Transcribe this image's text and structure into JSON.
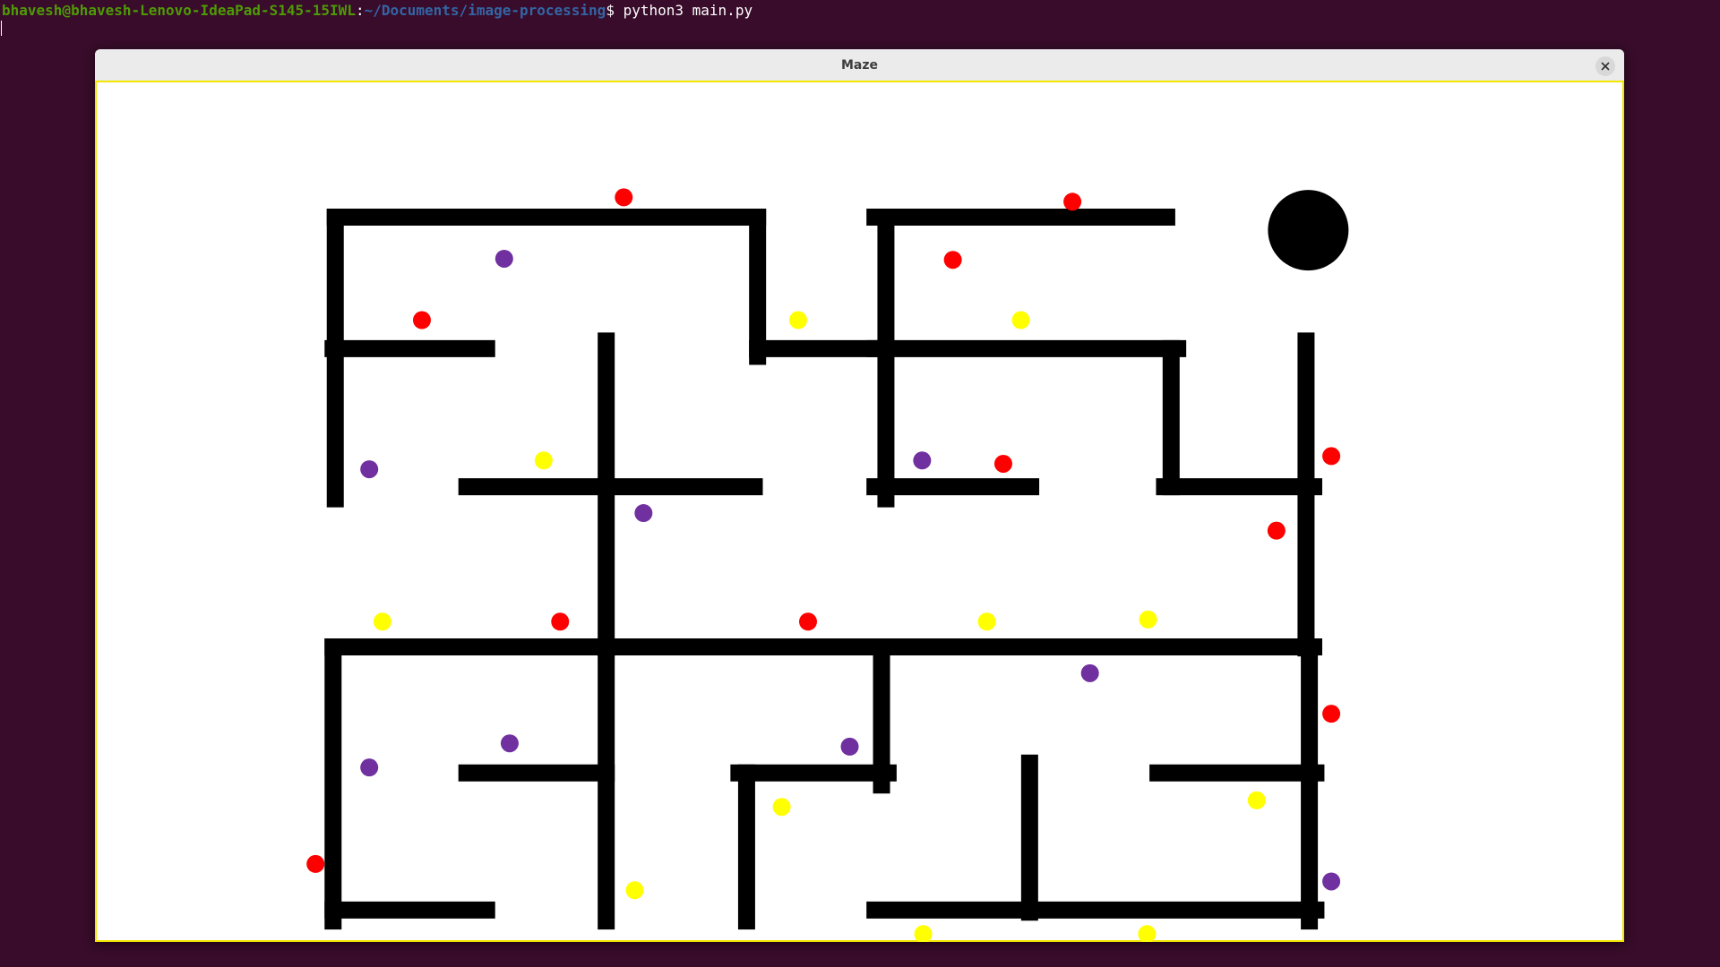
{
  "terminal": {
    "user_host": "bhavesh@bhavesh-Lenovo-IdeaPad-S145-15IWL",
    "separator": ":",
    "path": "~/Documents/image-processing",
    "dollar": "$",
    "command": " python3 main.py"
  },
  "window": {
    "title": "Maze",
    "close_icon": "close-icon"
  },
  "colors": {
    "terminal_bg": "#380c2a",
    "wall": "#000000",
    "red": "#ff0000",
    "yellow": "#ffff00",
    "purple": "#7030a0",
    "player": "#000000"
  },
  "maze": {
    "walls": [
      [
        304,
        198,
        689,
        198
      ],
      [
        304,
        198,
        304,
        455
      ],
      [
        689,
        198,
        689,
        325
      ],
      [
        689,
        318,
        806,
        318
      ],
      [
        302,
        318,
        442,
        318
      ],
      [
        551,
        311,
        551,
        591
      ],
      [
        424,
        444,
        686,
        444
      ],
      [
        806,
        198,
        806,
        455
      ],
      [
        796,
        198,
        1062,
        198
      ],
      [
        796,
        318,
        1072,
        318
      ],
      [
        1066,
        318,
        1066,
        444
      ],
      [
        796,
        444,
        938,
        444
      ],
      [
        1060,
        444,
        1196,
        444
      ],
      [
        1189,
        311,
        1189,
        591
      ],
      [
        302,
        590,
        1196,
        590
      ],
      [
        302,
        590,
        302,
        840
      ],
      [
        551,
        590,
        551,
        840
      ],
      [
        424,
        705,
        551,
        705
      ],
      [
        302,
        830,
        442,
        830
      ],
      [
        802,
        590,
        802,
        716
      ],
      [
        672,
        705,
        808,
        705
      ],
      [
        679,
        705,
        679,
        840
      ],
      [
        937,
        696,
        937,
        832
      ],
      [
        796,
        830,
        1198,
        830
      ],
      [
        1192,
        590,
        1192,
        840
      ],
      [
        1054,
        705,
        1198,
        705
      ]
    ],
    "player": [
      1191,
      210
    ],
    "dots": [
      [
        "red",
        567,
        180
      ],
      [
        "red",
        976,
        184
      ],
      [
        "purple",
        458,
        236
      ],
      [
        "red",
        867,
        237
      ],
      [
        "red",
        383,
        292
      ],
      [
        "yellow",
        726,
        292
      ],
      [
        "yellow",
        929,
        292
      ],
      [
        "yellow",
        494,
        420
      ],
      [
        "purple",
        335,
        428
      ],
      [
        "purple",
        839,
        420
      ],
      [
        "red",
        913,
        423
      ],
      [
        "purple",
        585,
        468
      ],
      [
        "red",
        1212,
        416
      ],
      [
        "red",
        1162,
        484
      ],
      [
        "yellow",
        347,
        567
      ],
      [
        "red",
        509,
        567
      ],
      [
        "red",
        735,
        567
      ],
      [
        "yellow",
        898,
        567
      ],
      [
        "yellow",
        1045,
        565
      ],
      [
        "purple",
        992,
        614
      ],
      [
        "red",
        1212,
        651
      ],
      [
        "purple",
        463,
        678
      ],
      [
        "purple",
        773,
        681
      ],
      [
        "purple",
        335,
        700
      ],
      [
        "yellow",
        711,
        736
      ],
      [
        "yellow",
        1144,
        730
      ],
      [
        "red",
        286,
        788
      ],
      [
        "yellow",
        577,
        812
      ],
      [
        "purple",
        1212,
        804
      ],
      [
        "yellow",
        840,
        852
      ],
      [
        "yellow",
        1044,
        852
      ]
    ]
  }
}
